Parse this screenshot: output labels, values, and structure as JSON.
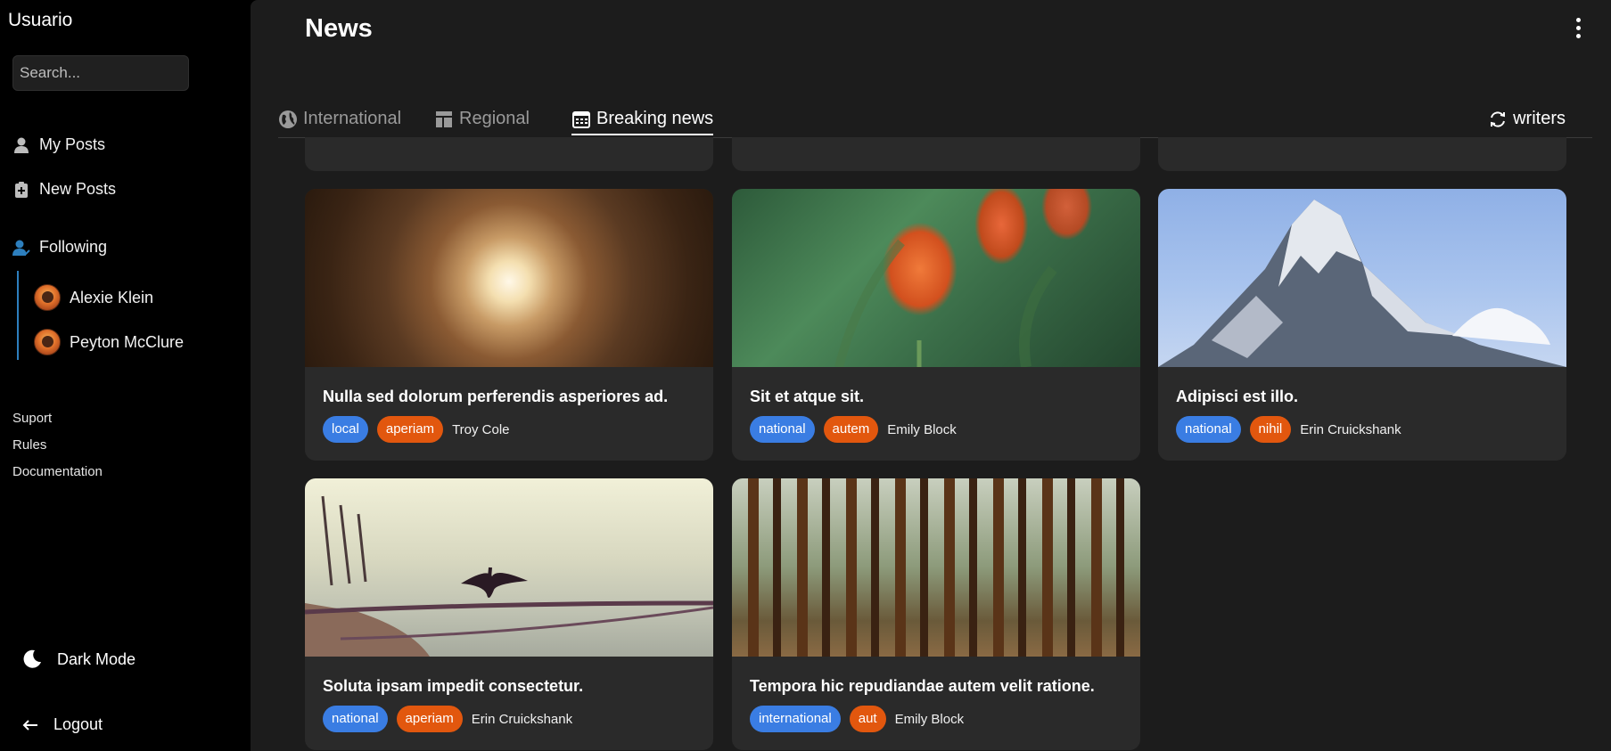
{
  "sidebar": {
    "user_name": "Usuario",
    "search_placeholder": "Search...",
    "nav": {
      "my_posts": "My Posts",
      "new_posts": "New Posts",
      "following": "Following"
    },
    "following_users": [
      {
        "name": "Alexie Klein"
      },
      {
        "name": "Peyton McClure"
      }
    ],
    "links": {
      "support": "Suport",
      "rules": "Rules",
      "documentation": "Documentation"
    },
    "dark_mode": "Dark Mode",
    "logout": "Logout"
  },
  "header": {
    "title": "News"
  },
  "tabs": {
    "international": "International",
    "regional": "Regional",
    "breaking": "Breaking news",
    "active": "Breaking news",
    "writers": "writers"
  },
  "colors": {
    "tag_blue": "#3a7de3",
    "tag_orange": "#e2570e",
    "card_bg": "#2a2a2a",
    "main_bg": "#1c1c1c"
  },
  "cards": [
    {
      "title": "Nulla sed dolorum perferendis asperiores ad.",
      "tags": [
        "local",
        "aperiam"
      ],
      "author": "Troy Cole",
      "image": "tunnel"
    },
    {
      "title": "Sit et atque sit.",
      "tags": [
        "national",
        "autem"
      ],
      "author": "Emily Block",
      "image": "tulip"
    },
    {
      "title": "Adipisci est illo.",
      "tags": [
        "national",
        "nihil"
      ],
      "author": "Erin Cruickshank",
      "image": "mountain"
    },
    {
      "title": "Soluta ipsam impedit consectetur.",
      "tags": [
        "national",
        "aperiam"
      ],
      "author": "Erin Cruickshank",
      "image": "cormorant-on-rope"
    },
    {
      "title": "Tempora hic repudiandae autem velit ratione.",
      "tags": [
        "international",
        "aut"
      ],
      "author": "Emily Block",
      "image": "forest"
    }
  ]
}
